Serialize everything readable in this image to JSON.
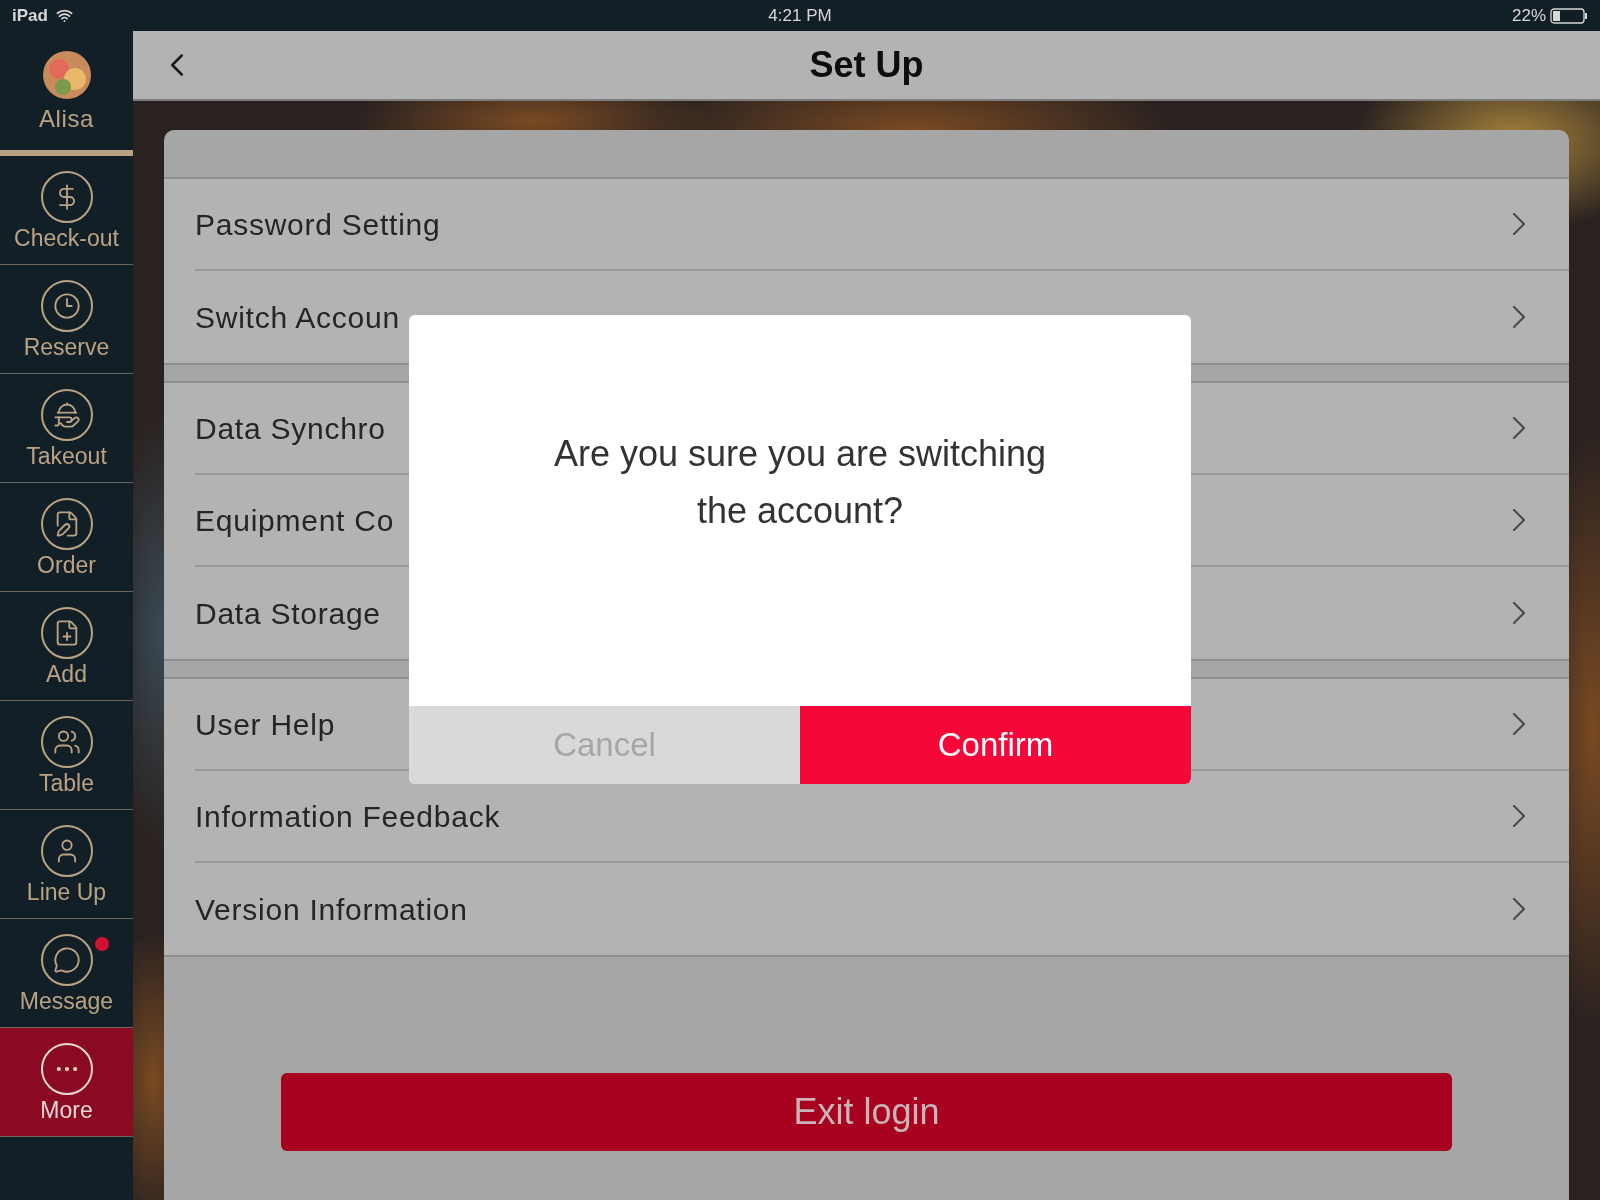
{
  "status_bar": {
    "device": "iPad",
    "time": "4:21 PM",
    "battery": "22%"
  },
  "user": {
    "name": "Alisa"
  },
  "sidebar": {
    "items": [
      {
        "label": "Check-out",
        "kind": "dollar",
        "selected": false,
        "unread": false
      },
      {
        "label": "Reserve",
        "kind": "clock",
        "selected": false,
        "unread": false
      },
      {
        "label": "Takeout",
        "kind": "platter",
        "selected": false,
        "unread": false
      },
      {
        "label": "Order",
        "kind": "order",
        "selected": false,
        "unread": false
      },
      {
        "label": "Add",
        "kind": "add",
        "selected": false,
        "unread": false
      },
      {
        "label": "Table",
        "kind": "users",
        "selected": false,
        "unread": false
      },
      {
        "label": "Line Up",
        "kind": "user",
        "selected": false,
        "unread": false
      },
      {
        "label": "Message",
        "kind": "message",
        "selected": false,
        "unread": true
      },
      {
        "label": "More",
        "kind": "more",
        "selected": true,
        "unread": false
      }
    ]
  },
  "header": {
    "title": "Set Up"
  },
  "settings": {
    "groups": [
      {
        "rows": [
          {
            "label": "Password Setting"
          },
          {
            "label": "Switch Accoun"
          }
        ]
      },
      {
        "rows": [
          {
            "label": "Data Synchro"
          },
          {
            "label": "Equipment Co"
          },
          {
            "label": "Data Storage"
          }
        ]
      },
      {
        "rows": [
          {
            "label": "User Help"
          },
          {
            "label": "Information Feedback"
          },
          {
            "label": "Version Information"
          }
        ]
      }
    ]
  },
  "exit_button": "Exit login",
  "dialog": {
    "message": "Are you sure you are switching the account?",
    "buttons": [
      {
        "label": "Cancel",
        "kind": "cancel"
      },
      {
        "label": "Confirm",
        "kind": "confirm"
      }
    ]
  }
}
